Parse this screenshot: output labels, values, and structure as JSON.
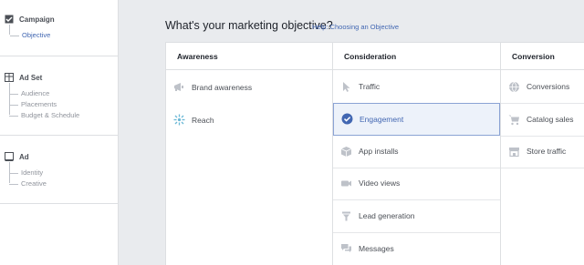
{
  "sidebar": {
    "campaign": {
      "title": "Campaign",
      "items": [
        "Objective"
      ]
    },
    "adset": {
      "title": "Ad Set",
      "items": [
        "Audience",
        "Placements",
        "Budget & Schedule"
      ]
    },
    "ad": {
      "title": "Ad",
      "items": [
        "Identity",
        "Creative"
      ]
    }
  },
  "main": {
    "title": "What's your marketing objective?",
    "help_link": "Help: Choosing an Objective"
  },
  "columns": [
    {
      "header": "Awareness",
      "options": [
        "Brand awareness",
        "Reach"
      ]
    },
    {
      "header": "Consideration",
      "options": [
        "Traffic",
        "Engagement",
        "App installs",
        "Video views",
        "Lead generation",
        "Messages"
      ]
    },
    {
      "header": "Conversion",
      "options": [
        "Conversions",
        "Catalog sales",
        "Store traffic"
      ]
    }
  ],
  "selected_option": "Engagement",
  "colors": {
    "accent": "#4267b2",
    "icon_gray": "#bec2c9",
    "selected_bg": "#edf2fa"
  },
  "icons": {
    "awareness": [
      "megaphone-icon",
      "reach-icon"
    ],
    "consideration": [
      "cursor-icon",
      "check-circle-icon",
      "app-box-icon",
      "video-camera-icon",
      "filter-icon",
      "chat-icon"
    ],
    "conversion": [
      "globe-icon",
      "cart-icon",
      "store-icon"
    ]
  }
}
